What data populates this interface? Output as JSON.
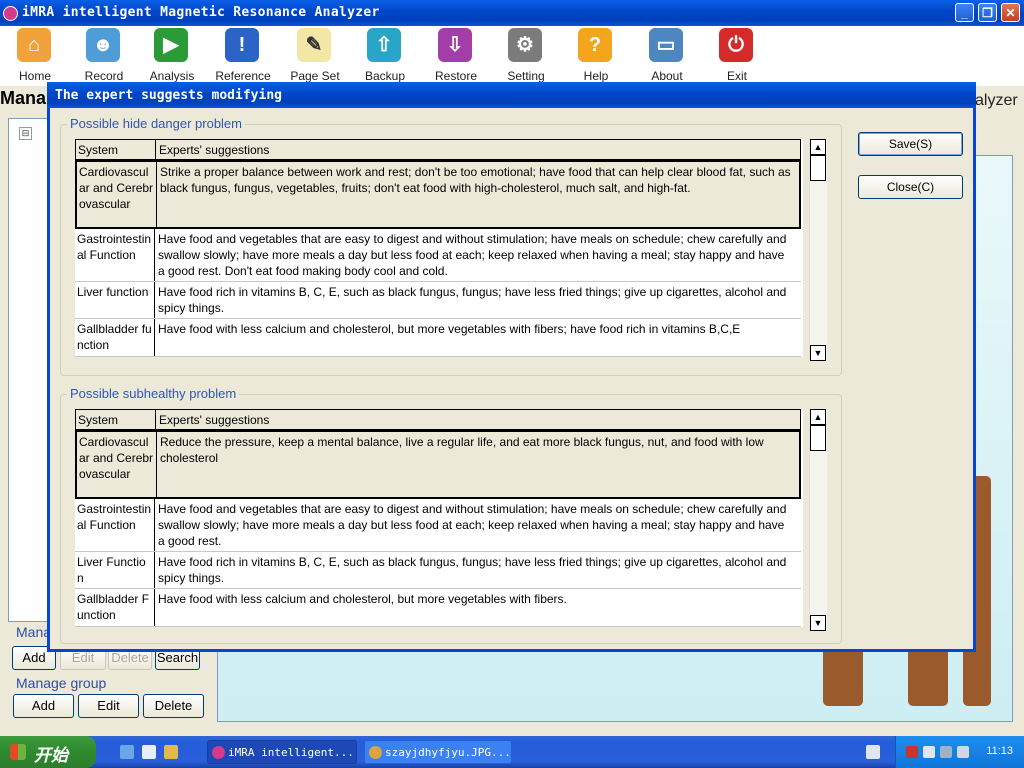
{
  "window": {
    "title": "iMRA intelligent Magnetic Resonance Analyzer",
    "controls": {
      "minimize": "_",
      "maximize": "❐",
      "close": "✕"
    }
  },
  "toolbar": [
    {
      "label": "Home",
      "icon": "home-icon",
      "color": "#f2a23a",
      "glyph": "⌂"
    },
    {
      "label": "Record",
      "icon": "users-icon",
      "color": "#4f9dd8",
      "glyph": "☻"
    },
    {
      "label": "Analysis",
      "icon": "play-icon",
      "color": "#2b9b3a",
      "glyph": "▶"
    },
    {
      "label": "Reference",
      "icon": "info-icon",
      "color": "#2b63c7",
      "glyph": "!"
    },
    {
      "label": "Page Set",
      "icon": "page-set-icon",
      "color": "#f3e7a8",
      "glyph": "✎"
    },
    {
      "label": "Backup",
      "icon": "backup-icon",
      "color": "#27a6c8",
      "glyph": "⇧"
    },
    {
      "label": "Restore",
      "icon": "restore-icon",
      "color": "#a33ea8",
      "glyph": "⇩"
    },
    {
      "label": "Setting",
      "icon": "settings-icon",
      "color": "#7b7b7b",
      "glyph": "⚙"
    },
    {
      "label": "Help",
      "icon": "help-icon",
      "color": "#f3a51c",
      "glyph": "?"
    },
    {
      "label": "About",
      "icon": "about-icon",
      "color": "#4e86c2",
      "glyph": "▭"
    },
    {
      "label": "Exit",
      "icon": "exit-icon",
      "color": "#d42a2a",
      "glyph": "⏻"
    }
  ],
  "background": {
    "manage_title": "Mana",
    "right_title": "alyzer",
    "tree_toggle": "⊟",
    "manage_user_label": "Mana",
    "user_buttons": {
      "add": "Add",
      "edit": "Edit",
      "delete": "Delete",
      "search": "Search"
    },
    "manage_group_label": "Manage group",
    "group_buttons": {
      "add": "Add",
      "edit": "Edit",
      "delete": "Delete"
    }
  },
  "dialog": {
    "title": "The expert suggests modifying",
    "save_label": "Save(S)",
    "close_label": "Close(C)",
    "scroll_up": "▲",
    "scroll_down": "▼",
    "sections": [
      {
        "label": "Possible hide danger problem",
        "headers": [
          "System",
          "Experts' suggestions"
        ],
        "rows": [
          {
            "system": "Cardiovascular and Cerebrovascular",
            "suggestion": "Strike a proper balance between work and rest; don't be too emotional; have food that can help clear blood fat, such as black fungus, fungus, vegetables, fruits; don't eat food with high-cholesterol, much salt, and high-fat."
          },
          {
            "system": "Gastrointestinal Function",
            "suggestion": "Have food and vegetables that are easy to digest and without stimulation; have meals on schedule; chew carefully and swallow slowly; have more meals a day but less food at each; keep relaxed when having a meal; stay happy and have a good rest. Don't eat food making body cool and cold."
          },
          {
            "system": "Liver function",
            "suggestion": "Have food rich in vitamins B, C, E, such as black fungus, fungus; have less fried things; give up cigarettes, alcohol and spicy things."
          },
          {
            "system": "Gallbladder function",
            "suggestion": "Have food with less calcium and cholesterol, but more vegetables with fibers; have food rich in vitamins B,C,E"
          }
        ]
      },
      {
        "label": "Possible subhealthy problem",
        "headers": [
          "System",
          "Experts' suggestions"
        ],
        "rows": [
          {
            "system": "Cardiovascular and Cerebrovascular",
            "suggestion": "Reduce the pressure, keep a mental balance, live a regular life, and eat more black fungus, nut, and food with low cholesterol"
          },
          {
            "system": "Gastrointestinal Function",
            "suggestion": "Have food and vegetables that are easy to digest and without stimulation; have meals on schedule; chew carefully and swallow slowly; have more meals a day but less food at each; keep relaxed when having a meal; stay happy and have a good rest."
          },
          {
            "system": "Liver Function",
            "suggestion": "Have food rich in vitamins B, C, E, such as black fungus, fungus; have less fried things; give up cigarettes, alcohol and spicy things."
          },
          {
            "system": "Gallbladder Function",
            "suggestion": "Have food with less calcium and cholesterol, but more vegetables with fibers."
          }
        ]
      }
    ]
  },
  "taskbar": {
    "start_label": "开始",
    "tasks": [
      {
        "label": "iMRA intelligent...",
        "active": true
      },
      {
        "label": "szayjdhyfjyu.JPG...",
        "active": false
      }
    ],
    "clock": "11:13"
  }
}
